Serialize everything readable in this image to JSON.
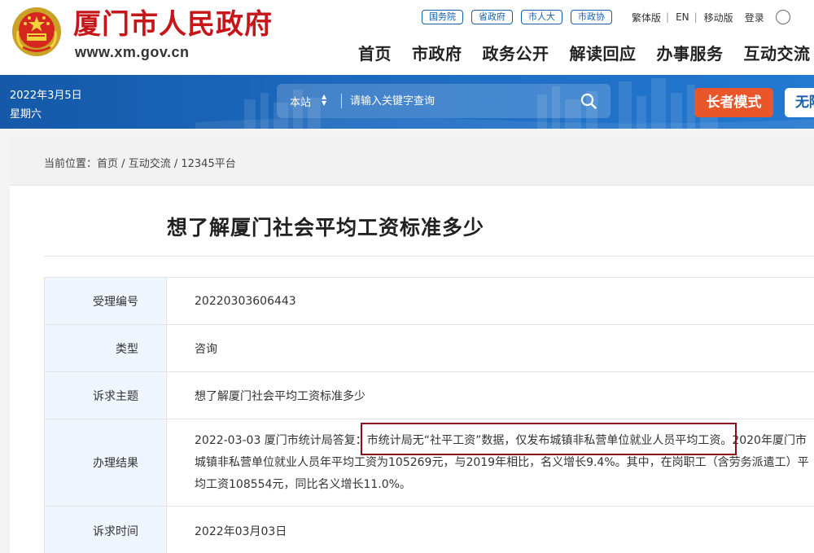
{
  "header": {
    "site_name": "厦门市人民政府",
    "site_url": "www.xm.gov.cn",
    "top_links": [
      "国务院",
      "省政府",
      "市人大",
      "市政协"
    ],
    "utilities": [
      "繁体版",
      "EN",
      "移动版",
      "登录"
    ],
    "nav": [
      "首页",
      "市政府",
      "政务公开",
      "解读回应",
      "办事服务",
      "互动交流"
    ]
  },
  "banner": {
    "date": "2022年3月5日",
    "weekday": "星期六",
    "search_scope": "本站",
    "search_placeholder": "请输入关键字查询",
    "elder_mode": "长者模式",
    "accessibility": "无障碍"
  },
  "breadcrumb": {
    "prefix": "当前位置：",
    "items": [
      "首页",
      "互动交流",
      "12345平台"
    ],
    "separator": " / "
  },
  "page_title": "想了解厦门社会平均工资标准多少",
  "details": [
    {
      "label": "受理编号",
      "value": "20220303606443"
    },
    {
      "label": "类型",
      "value": "咨询"
    },
    {
      "label": "诉求主题",
      "value": "想了解厦门社会平均工资标准多少"
    },
    {
      "label": "办理结果",
      "value": "2022-03-03 厦门市统计局答复：市统计局无“社平工资”数据，仅发布城镇非私营单位就业人员平均工资。2020年厦门市城镇非私营单位就业人员年平均工资为105269元，与2019年相比，名义增长9.4%。其中，在岗职工（含劳务派遣工）平均工资108554元，同比名义增长11.0%。"
    },
    {
      "label": "诉求时间",
      "value": "2022年03月03日"
    }
  ],
  "colors": {
    "brand_red": "#c6161a",
    "banner_blue": "#1d6cc2",
    "elder_orange": "#e8562a",
    "label_bg": "#eff6ff",
    "highlight_border": "#8b0f1a"
  }
}
